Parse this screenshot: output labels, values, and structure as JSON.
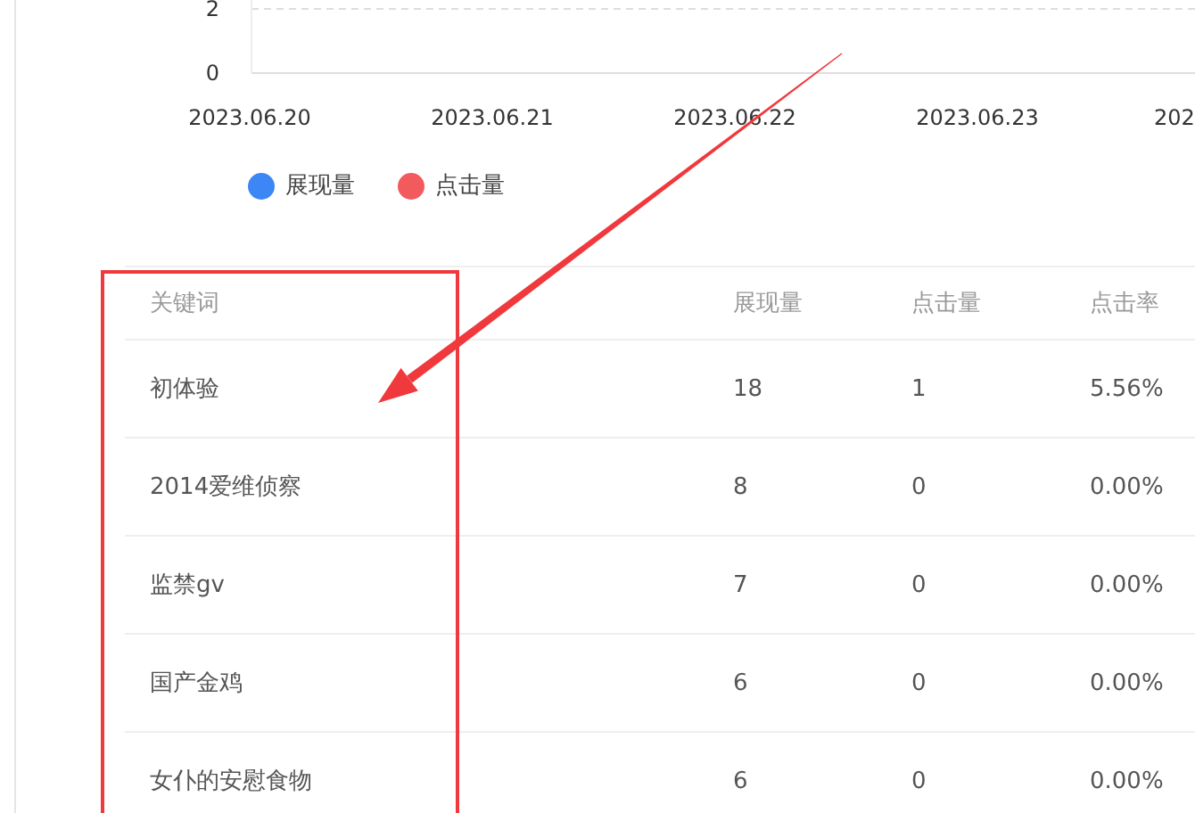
{
  "chart": {
    "chart_data": {
      "type": "line",
      "categories": [
        "2023.06.20",
        "2023.06.21",
        "2023.06.22",
        "2023.06.23",
        "202"
      ],
      "ylim": [
        0,
        2
      ],
      "yticks": [
        0,
        2
      ],
      "series": [
        {
          "name": "展现量",
          "color": "#3d86f5",
          "values": [
            null,
            null,
            null,
            null,
            null
          ]
        },
        {
          "name": "点击量",
          "color": "#f25a5e",
          "values": [
            null,
            null,
            null,
            null,
            null
          ]
        }
      ]
    }
  },
  "table": {
    "columns": [
      "关键词",
      "展现量",
      "点击量",
      "点击率"
    ],
    "rows": [
      [
        "初体验",
        "18",
        "1",
        "5.56%"
      ],
      [
        "2014爱维侦察",
        "8",
        "0",
        "0.00%"
      ],
      [
        "监禁gv",
        "7",
        "0",
        "0.00%"
      ],
      [
        "国产金鸡",
        "6",
        "0",
        "0.00%"
      ],
      [
        "女仆的安慰食物",
        "6",
        "0",
        "0.00%"
      ]
    ]
  }
}
